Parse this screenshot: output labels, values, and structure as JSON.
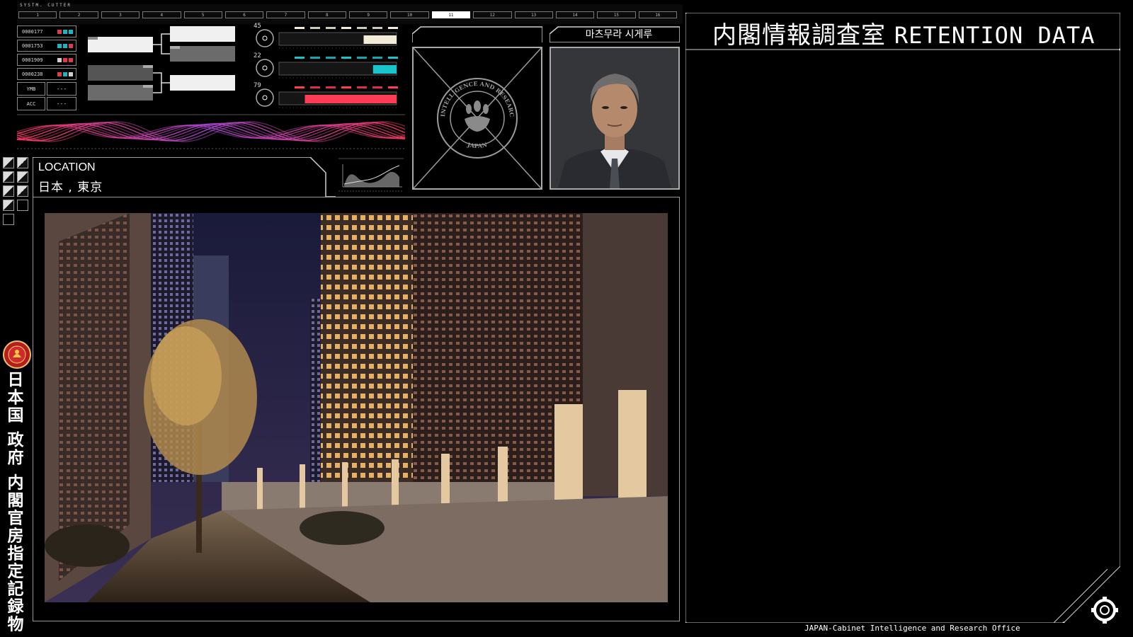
{
  "header": {
    "strip_label": "SYSTM. CUTTER",
    "tabs": [
      "1",
      "2",
      "3",
      "4",
      "5",
      "6",
      "7",
      "8",
      "9",
      "10",
      "11",
      "12",
      "13",
      "14",
      "15",
      "16"
    ],
    "active_tab": 10
  },
  "codes": [
    {
      "id": "0000177",
      "colors": [
        "#e23a4a",
        "#19b6c4",
        "#19b6c4"
      ]
    },
    {
      "id": "0001753",
      "colors": [
        "#19b6c4",
        "#19b6c4",
        "#e23a4a"
      ]
    },
    {
      "id": "0001909",
      "colors": [
        "#cfcfcf",
        "#e23a4a",
        "#e23a4a"
      ]
    },
    {
      "id": "0000238",
      "colors": [
        "#e23a4a",
        "#19b6c4",
        "#cfcfcf"
      ]
    }
  ],
  "kv": [
    {
      "key": "YMB",
      "value": "---"
    },
    {
      "key": "ACC",
      "value": "---"
    }
  ],
  "meters": [
    {
      "number": "45",
      "color": "#f2ecd8",
      "level": 0.28
    },
    {
      "number": "22",
      "color": "#19c4cc",
      "level": 0.2
    },
    {
      "number": "79",
      "color": "#ff3b55",
      "level": 0.78
    }
  ],
  "location": {
    "label": "LOCATION",
    "value": "日本 , 東京"
  },
  "seal": {
    "top_text": "CABINET INTELLIGENCE AND RESEARCH OFFICE",
    "bottom_text": "JAPAN"
  },
  "person": {
    "name": "마츠무라 시게루"
  },
  "right_panel": {
    "title_jp": "内閣情報調査室",
    "title_en": "RETENTION DATA"
  },
  "sidebar": {
    "vertical_text": "日本国 政府 内閣官房指定記録物"
  },
  "footer": {
    "text": "JAPAN-Cabinet Intelligence and Research Office"
  },
  "icons": {
    "settings": "gear-icon",
    "emblem": "government-emblem-icon",
    "seal": "cabinet-seal-icon"
  },
  "colors": {
    "accent_cyan": "#19b6c4",
    "accent_red": "#e23a4a",
    "panel_border": "#aaaaaa"
  }
}
